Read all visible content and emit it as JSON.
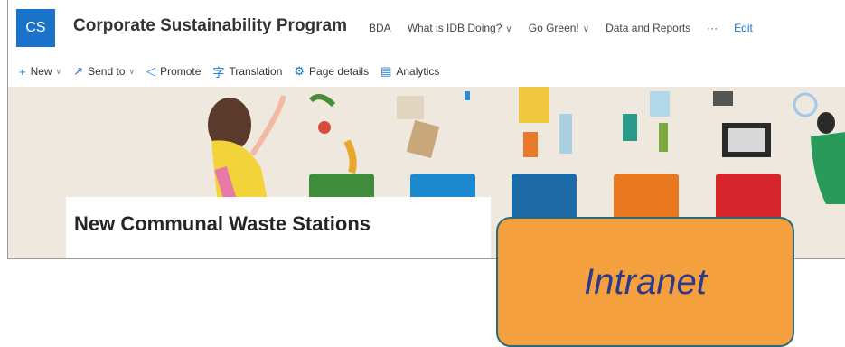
{
  "header": {
    "logo_initials": "CS",
    "site_title": "Corporate Sustainability Program",
    "nav": [
      {
        "label": "BDA",
        "has_dropdown": false
      },
      {
        "label": "What is IDB Doing?",
        "has_dropdown": true
      },
      {
        "label": "Go Green!",
        "has_dropdown": true
      },
      {
        "label": "Data and Reports",
        "has_dropdown": false
      },
      {
        "label": "···",
        "has_dropdown": false
      },
      {
        "label": "Edit",
        "has_dropdown": false
      }
    ],
    "accent_color": "#1a73c9"
  },
  "toolbar": {
    "new": "New",
    "send_to": "Send to",
    "promote": "Promote",
    "translation": "Translation",
    "page_details": "Page details",
    "analytics": "Analytics"
  },
  "page": {
    "title": "New Communal Waste Stations",
    "bin_colors": [
      "#3f8d3a",
      "#1d8ad0",
      "#1c6aa8",
      "#e8781f",
      "#d6262b"
    ]
  },
  "callout": {
    "text": "Intranet",
    "color": "#f5a03e"
  }
}
